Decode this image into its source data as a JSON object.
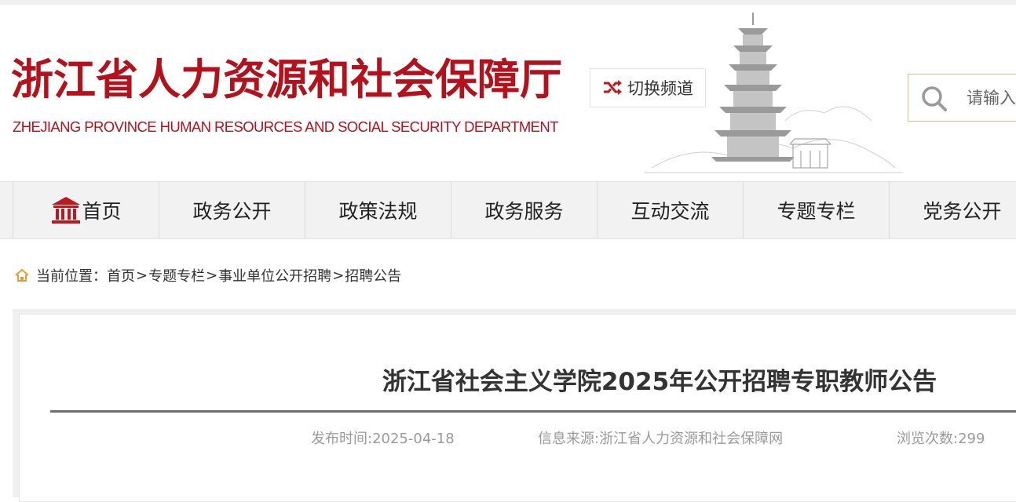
{
  "header": {
    "logo_cn": "浙江省人力资源和社会保障厅",
    "logo_en": "ZHEJIANG PROVINCE HUMAN RESOURCES AND SOCIAL SECURITY DEPARTMENT",
    "switch_label": "切换频道",
    "search_placeholder": "请输入"
  },
  "nav": {
    "items": [
      {
        "label": "首页",
        "icon": "home-icon"
      },
      {
        "label": "政务公开"
      },
      {
        "label": "政策法规"
      },
      {
        "label": "政务服务"
      },
      {
        "label": "互动交流"
      },
      {
        "label": "专题专栏"
      },
      {
        "label": "党务公开"
      }
    ]
  },
  "breadcrumb": {
    "prefix": "当前位置：",
    "items": [
      "首页",
      "专题专栏",
      "事业单位公开招聘",
      "招聘公告"
    ],
    "separator": ">"
  },
  "article": {
    "title": "浙江省社会主义学院2025年公开招聘专职教师公告",
    "publish_time": "发布时间:2025-04-18",
    "source": "信息来源:浙江省人力资源和社会保障网",
    "views": "浏览次数:299"
  },
  "colors": {
    "brand_red": "#b3121c",
    "nav_bg": "#f2f2f2",
    "search_border": "#d9c08a",
    "breadcrumb_icon": "#e0a030"
  }
}
